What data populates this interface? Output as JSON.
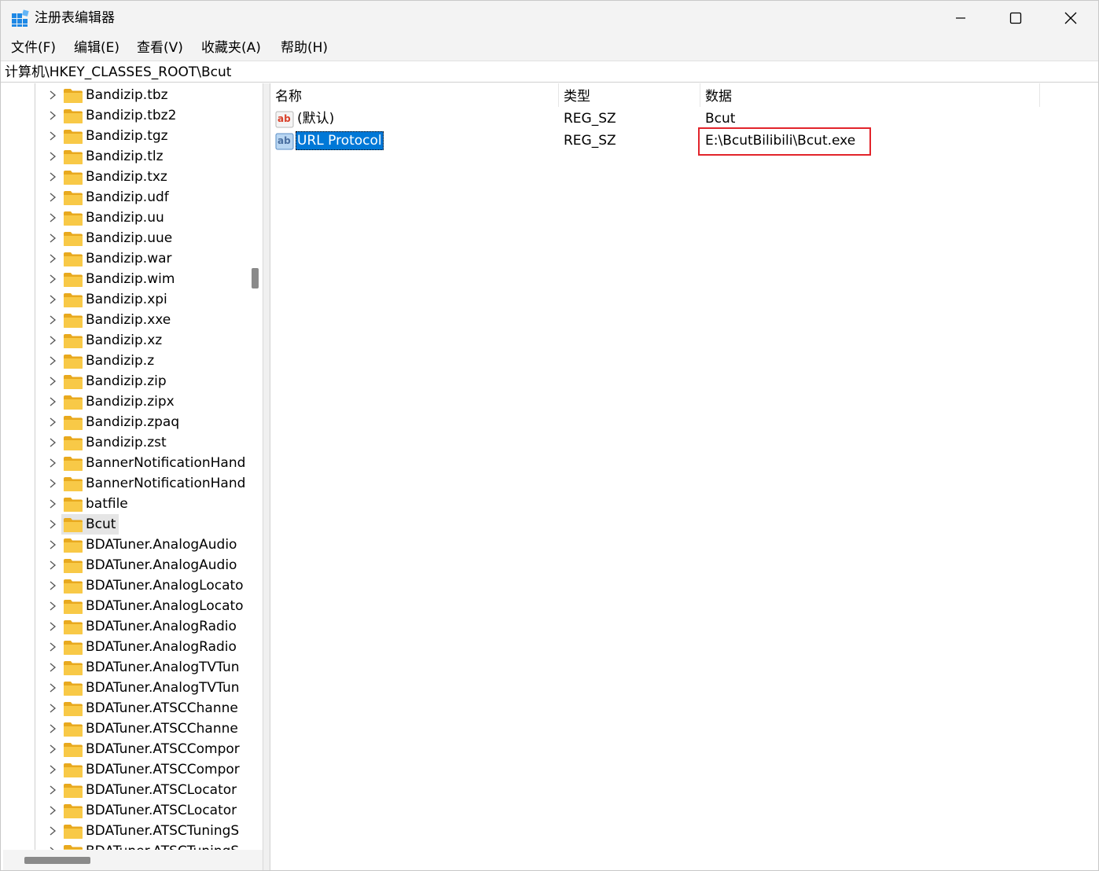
{
  "window": {
    "title": "注册表编辑器"
  },
  "menu": [
    "文件(F)",
    "编辑(E)",
    "查看(V)",
    "收藏夹(A)",
    "帮助(H)"
  ],
  "address": "计算机\\HKEY_CLASSES_ROOT\\Bcut",
  "tree": {
    "items": [
      {
        "label": "Bandizip.tbz"
      },
      {
        "label": "Bandizip.tbz2"
      },
      {
        "label": "Bandizip.tgz"
      },
      {
        "label": "Bandizip.tlz"
      },
      {
        "label": "Bandizip.txz"
      },
      {
        "label": "Bandizip.udf"
      },
      {
        "label": "Bandizip.uu"
      },
      {
        "label": "Bandizip.uue"
      },
      {
        "label": "Bandizip.war"
      },
      {
        "label": "Bandizip.wim"
      },
      {
        "label": "Bandizip.xpi"
      },
      {
        "label": "Bandizip.xxe"
      },
      {
        "label": "Bandizip.xz"
      },
      {
        "label": "Bandizip.z"
      },
      {
        "label": "Bandizip.zip"
      },
      {
        "label": "Bandizip.zipx"
      },
      {
        "label": "Bandizip.zpaq"
      },
      {
        "label": "Bandizip.zst"
      },
      {
        "label": "BannerNotificationHand"
      },
      {
        "label": "BannerNotificationHand"
      },
      {
        "label": "batfile"
      },
      {
        "label": "Bcut",
        "selected": true
      },
      {
        "label": "BDATuner.AnalogAudio"
      },
      {
        "label": "BDATuner.AnalogAudio"
      },
      {
        "label": "BDATuner.AnalogLocato"
      },
      {
        "label": "BDATuner.AnalogLocato"
      },
      {
        "label": "BDATuner.AnalogRadio"
      },
      {
        "label": "BDATuner.AnalogRadio"
      },
      {
        "label": "BDATuner.AnalogTVTun"
      },
      {
        "label": "BDATuner.AnalogTVTun"
      },
      {
        "label": "BDATuner.ATSCChanne"
      },
      {
        "label": "BDATuner.ATSCChanne"
      },
      {
        "label": "BDATuner.ATSCCompor"
      },
      {
        "label": "BDATuner.ATSCCompor"
      },
      {
        "label": "BDATuner.ATSCLocator"
      },
      {
        "label": "BDATuner.ATSCLocator"
      },
      {
        "label": "BDATuner.ATSCTuningS"
      },
      {
        "label": "BDATuner.ATSCTuningS"
      }
    ]
  },
  "values": {
    "columns": {
      "name": "名称",
      "type": "类型",
      "data": "数据"
    },
    "rows": [
      {
        "name": "(默认)",
        "type": "REG_SZ",
        "data": "Bcut",
        "icon": "string-value-icon"
      },
      {
        "name": "URL Protocol",
        "type": "REG_SZ",
        "data": "E:\\BcutBilibili\\Bcut.exe",
        "icon": "string-value-icon",
        "selected": true
      }
    ]
  },
  "colors": {
    "selection": "#0078d7",
    "highlight_box": "#e2242b",
    "folder": "#f8c947"
  }
}
